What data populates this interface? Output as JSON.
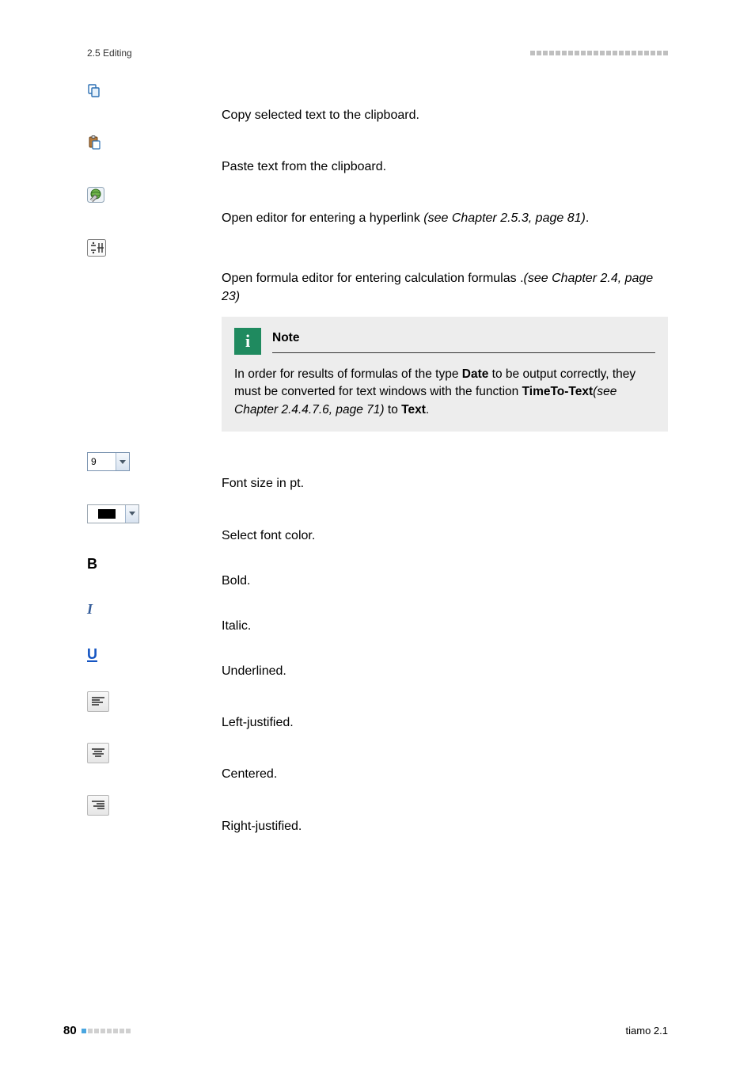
{
  "header": {
    "section_label": "2.5 Editing"
  },
  "rows": {
    "copy": {
      "desc": "Copy selected text to the clipboard."
    },
    "paste": {
      "desc": "Paste text from the clipboard."
    },
    "hyper": {
      "desc_pre": "Open editor for entering a hyperlink ",
      "ref": "(see Chapter 2.5.3, page 81)",
      "desc_post": "."
    },
    "formula": {
      "desc_pre": "Open formula editor for entering calculation formulas .",
      "ref": "(see Chapter 2.4, page 23)"
    },
    "size": {
      "value": "9",
      "desc": "Font size in pt."
    },
    "color": {
      "desc": "Select font color."
    },
    "bold": {
      "desc": "Bold."
    },
    "italic": {
      "desc": "Italic."
    },
    "under": {
      "desc": "Underlined."
    },
    "left": {
      "desc": "Left-justified."
    },
    "center": {
      "desc": "Centered."
    },
    "right": {
      "desc": "Right-justified."
    }
  },
  "note": {
    "title": "Note",
    "pre": "In order for results of formulas of the type ",
    "b1": "Date",
    "mid1": " to be output correctly, they must be converted for text windows with the function ",
    "b2": "TimeTo-Text",
    "ref": "(see Chapter 2.4.4.7.6, page 71)",
    "mid2": " to ",
    "b3": "Text",
    "post": "."
  },
  "footer": {
    "page": "80",
    "product": "tiamo 2.1"
  }
}
